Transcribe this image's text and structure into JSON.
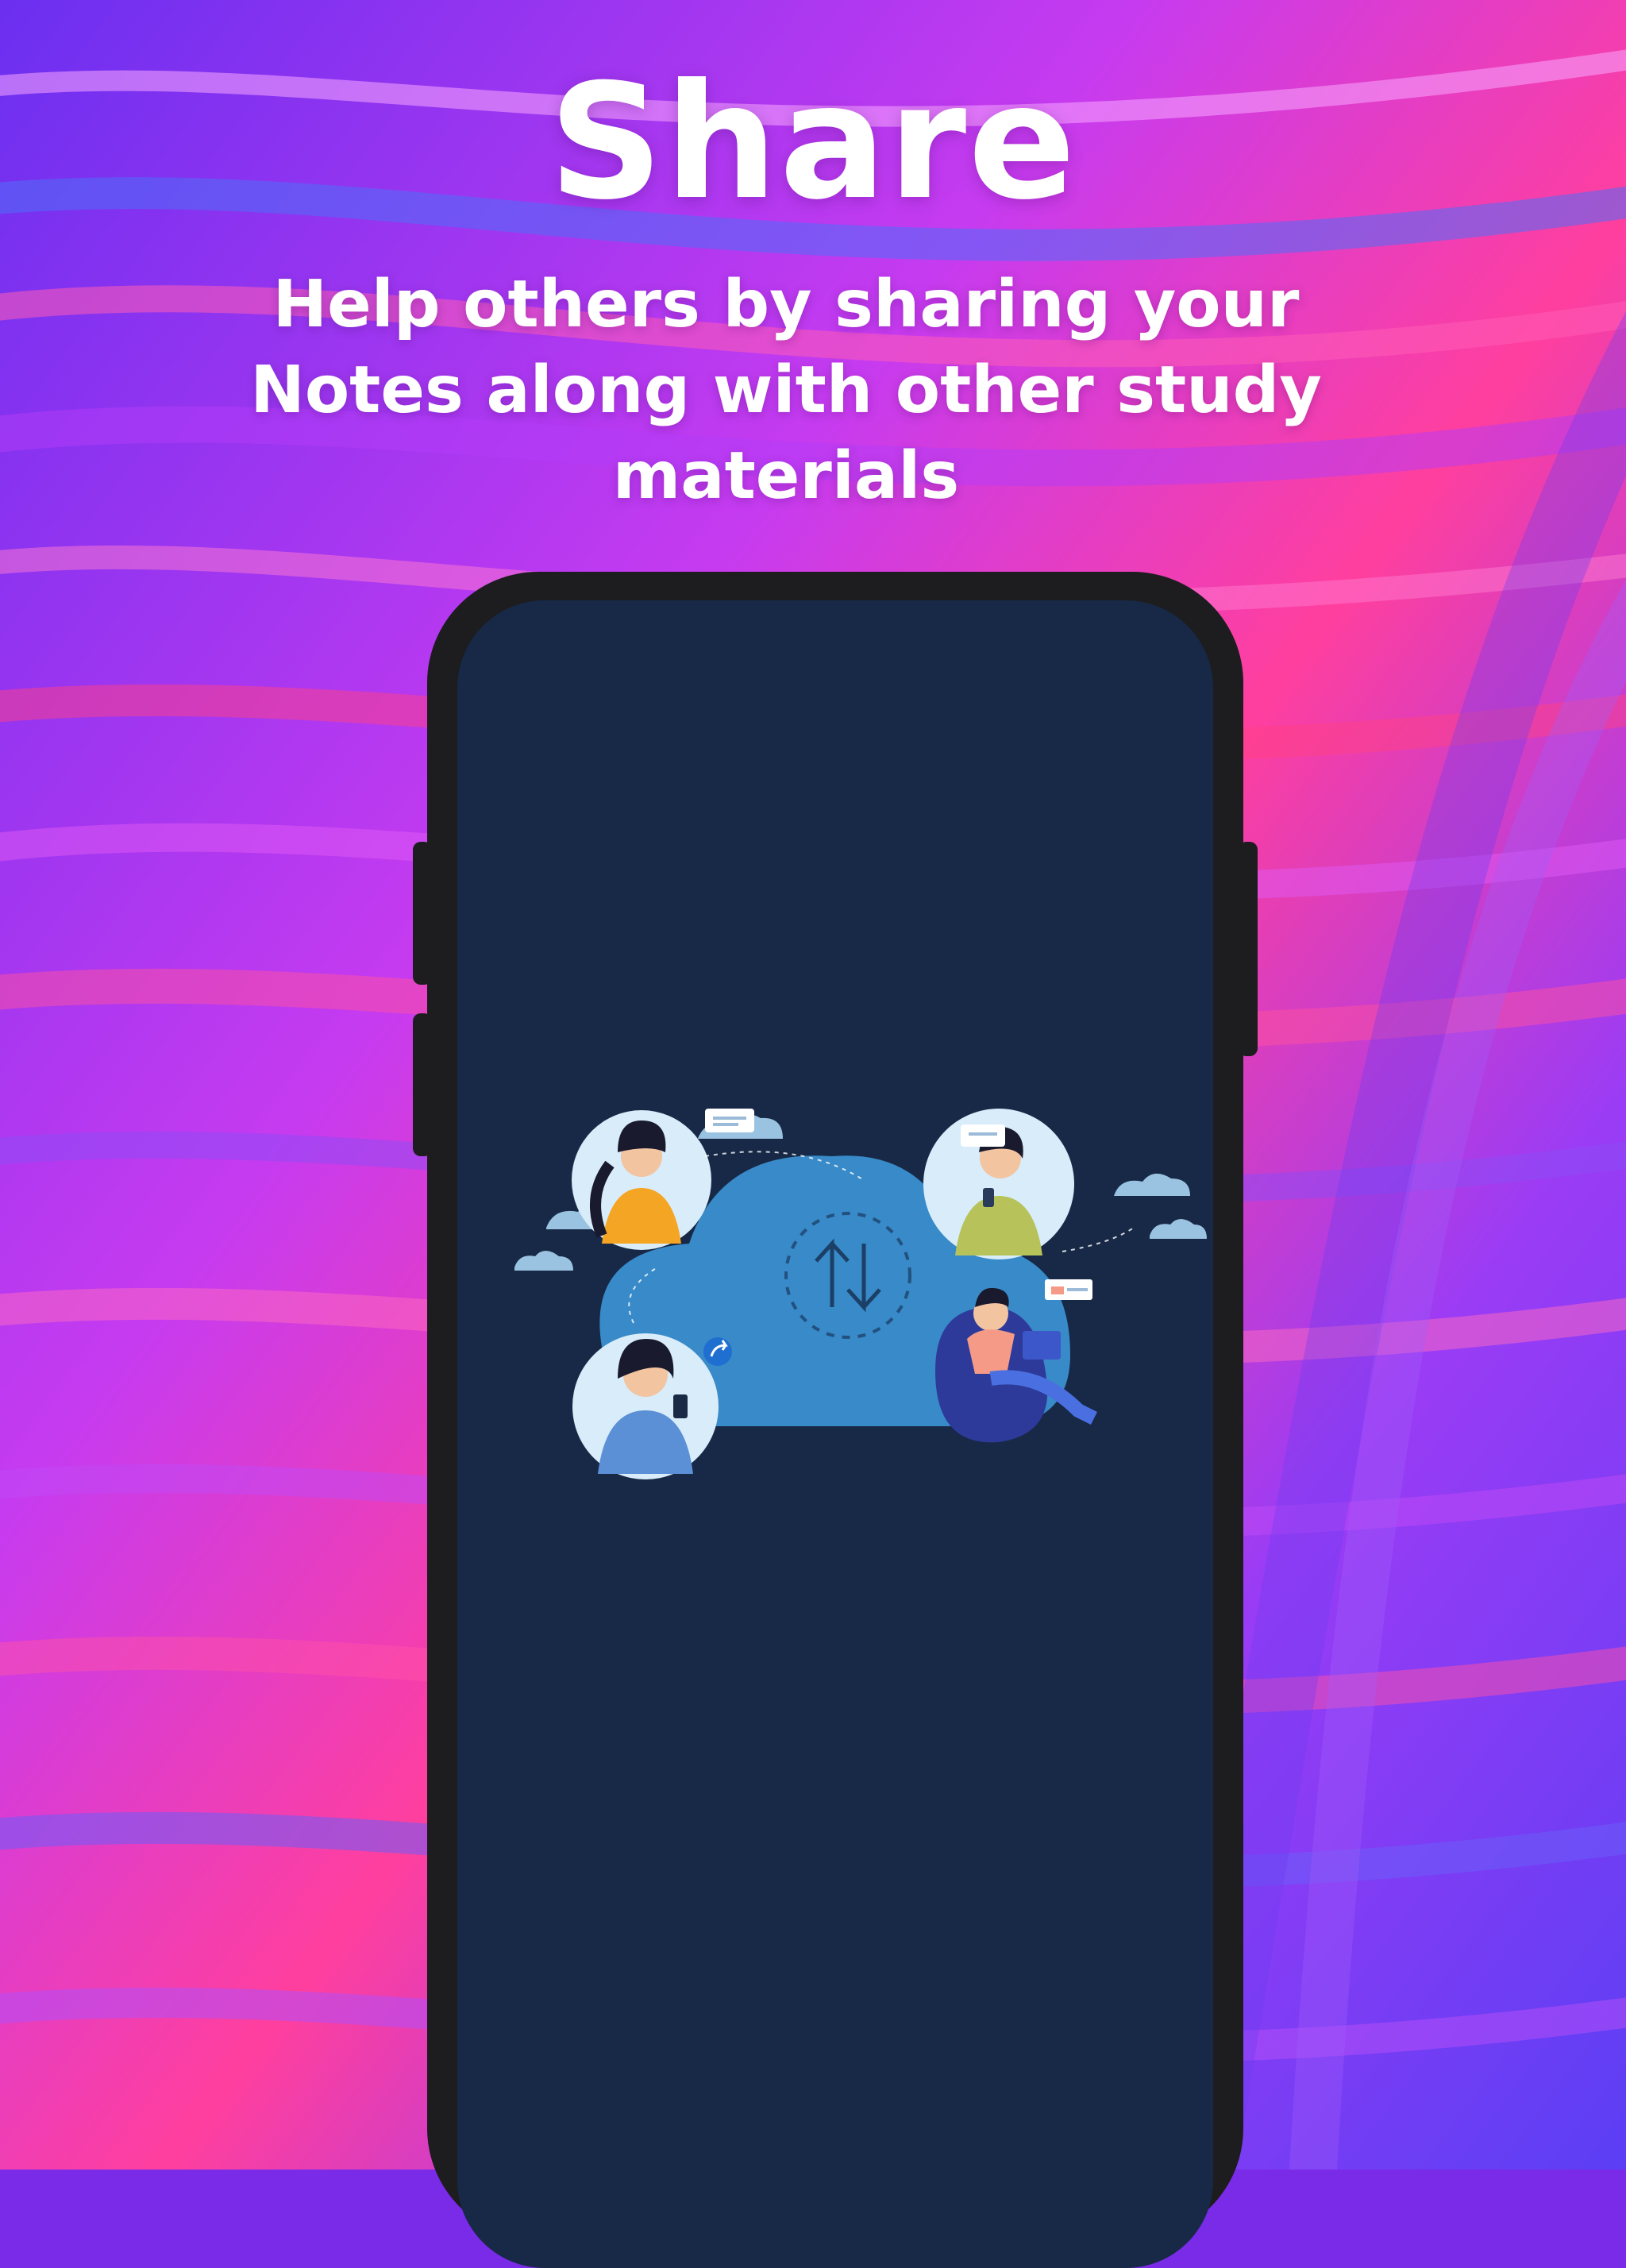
{
  "headline": "Share",
  "subtitle_lines": [
    "Help others by sharing your",
    "Notes along with other study",
    "materials"
  ],
  "colors": {
    "screen_bg": "#172946",
    "phone_frame": "#1d1d1f",
    "cloud_blue": "#3a8fd0",
    "accent_pink": "#ff3fa4",
    "accent_purple": "#7a2be8"
  },
  "illustration": {
    "icons": [
      "cloud-icon",
      "sync-arrows-icon",
      "chat-bubble-icon",
      "share-icon",
      "person-with-phone-icon",
      "person-with-laptop-icon"
    ]
  }
}
